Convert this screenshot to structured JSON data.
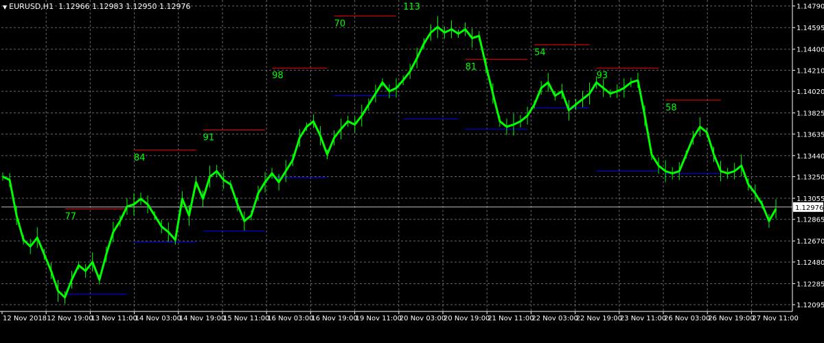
{
  "header": {
    "symbol": "EURUSD,H1",
    "ohlc": "1.12966 1.12983 1.12950 1.12976",
    "menu_icon": "triangle-down-icon"
  },
  "colors": {
    "background": "#000000",
    "grid": "#c0c0c0",
    "axis": "#ffffff",
    "candle": "#00ff00",
    "resistance": "#ff0000",
    "support": "#0000ff",
    "label": "#00ff00",
    "current_price_line": "#c0c0c0"
  },
  "chart_data": {
    "type": "line",
    "ylim": [
      1.12034,
      1.14844
    ],
    "y_ticks": [
      "1.14790",
      "1.14595",
      "1.14400",
      "1.14210",
      "1.14020",
      "1.13825",
      "1.13635",
      "1.13440",
      "1.13250",
      "1.13055",
      "1.12865",
      "1.12670",
      "1.12480",
      "1.12285",
      "1.12095"
    ],
    "x_ticks": [
      "12 Nov 2018",
      "12 Nov 19:00",
      "13 Nov 11:00",
      "14 Nov 03:00",
      "14 Nov 19:00",
      "15 Nov 11:00",
      "16 Nov 03:00",
      "16 Nov 19:00",
      "19 Nov 11:00",
      "20 Nov 03:00",
      "20 Nov 19:00",
      "21 Nov 11:00",
      "22 Nov 03:00",
      "22 Nov 19:00",
      "23 Nov 11:00",
      "26 Nov 03:00",
      "26 Nov 19:00",
      "27 Nov 11:00"
    ],
    "current_price": "1.12976",
    "price_series": [
      [
        0,
        1.1325
      ],
      [
        1,
        1.1322
      ],
      [
        2,
        1.129
      ],
      [
        3,
        1.1268
      ],
      [
        4,
        1.1262
      ],
      [
        5,
        1.127
      ],
      [
        6,
        1.1255
      ],
      [
        7,
        1.124
      ],
      [
        8,
        1.1222
      ],
      [
        9,
        1.1216
      ],
      [
        10,
        1.1232
      ],
      [
        11,
        1.1245
      ],
      [
        12,
        1.124
      ],
      [
        13,
        1.1248
      ],
      [
        14,
        1.1232
      ],
      [
        15,
        1.1255
      ],
      [
        16,
        1.1275
      ],
      [
        17,
        1.1285
      ],
      [
        18,
        1.1298
      ],
      [
        19,
        1.13
      ],
      [
        20,
        1.1305
      ],
      [
        21,
        1.13
      ],
      [
        22,
        1.129
      ],
      [
        23,
        1.128
      ],
      [
        24,
        1.1275
      ],
      [
        25,
        1.1268
      ],
      [
        26,
        1.1305
      ],
      [
        27,
        1.129
      ],
      [
        28,
        1.132
      ],
      [
        29,
        1.1305
      ],
      [
        30,
        1.1325
      ],
      [
        31,
        1.133
      ],
      [
        32,
        1.1322
      ],
      [
        33,
        1.1318
      ],
      [
        34,
        1.13
      ],
      [
        35,
        1.1285
      ],
      [
        36,
        1.129
      ],
      [
        37,
        1.131
      ],
      [
        38,
        1.132
      ],
      [
        39,
        1.1328
      ],
      [
        40,
        1.132
      ],
      [
        41,
        1.133
      ],
      [
        42,
        1.134
      ],
      [
        43,
        1.136
      ],
      [
        44,
        1.137
      ],
      [
        45,
        1.1375
      ],
      [
        46,
        1.1362
      ],
      [
        47,
        1.1345
      ],
      [
        48,
        1.136
      ],
      [
        49,
        1.1368
      ],
      [
        50,
        1.1375
      ],
      [
        51,
        1.1372
      ],
      [
        52,
        1.138
      ],
      [
        53,
        1.139
      ],
      [
        54,
        1.14
      ],
      [
        55,
        1.141
      ],
      [
        56,
        1.1402
      ],
      [
        57,
        1.1405
      ],
      [
        58,
        1.1412
      ],
      [
        59,
        1.142
      ],
      [
        60,
        1.1432
      ],
      [
        61,
        1.1445
      ],
      [
        62,
        1.1455
      ],
      [
        63,
        1.146
      ],
      [
        64,
        1.1455
      ],
      [
        65,
        1.1458
      ],
      [
        66,
        1.1454
      ],
      [
        67,
        1.1458
      ],
      [
        68,
        1.145
      ],
      [
        69,
        1.1452
      ],
      [
        70,
        1.1425
      ],
      [
        71,
        1.14
      ],
      [
        72,
        1.1375
      ],
      [
        73,
        1.137
      ],
      [
        74,
        1.1372
      ],
      [
        75,
        1.1375
      ],
      [
        76,
        1.138
      ],
      [
        77,
        1.139
      ],
      [
        78,
        1.1405
      ],
      [
        79,
        1.141
      ],
      [
        80,
        1.1398
      ],
      [
        81,
        1.1402
      ],
      [
        82,
        1.1385
      ],
      [
        83,
        1.139
      ],
      [
        84,
        1.1395
      ],
      [
        85,
        1.14
      ],
      [
        86,
        1.141
      ],
      [
        87,
        1.1405
      ],
      [
        88,
        1.14
      ],
      [
        89,
        1.1402
      ],
      [
        90,
        1.1405
      ],
      [
        91,
        1.141
      ],
      [
        92,
        1.1412
      ],
      [
        93,
        1.138
      ],
      [
        94,
        1.1345
      ],
      [
        95,
        1.1335
      ],
      [
        96,
        1.133
      ],
      [
        97,
        1.1328
      ],
      [
        98,
        1.133
      ],
      [
        99,
        1.1345
      ],
      [
        100,
        1.136
      ],
      [
        101,
        1.137
      ],
      [
        102,
        1.1365
      ],
      [
        103,
        1.1345
      ],
      [
        104,
        1.133
      ],
      [
        105,
        1.1328
      ],
      [
        106,
        1.133
      ],
      [
        107,
        1.1335
      ],
      [
        108,
        1.1318
      ],
      [
        109,
        1.131
      ],
      [
        110,
        1.13
      ],
      [
        111,
        1.1285
      ],
      [
        112,
        1.1296
      ]
    ],
    "levels": [
      {
        "label": "77",
        "high": 1.1296,
        "low": 1.1219,
        "from": 9,
        "to": 18
      },
      {
        "label": "84",
        "high": 1.1349,
        "low": 1.1266,
        "from": 19,
        "to": 28
      },
      {
        "label": "91",
        "high": 1.1367,
        "low": 1.1276,
        "from": 29,
        "to": 38
      },
      {
        "label": "98",
        "high": 1.1423,
        "low": 1.1324,
        "from": 39,
        "to": 47
      },
      {
        "label": "70",
        "high": 1.147,
        "low": 1.1398,
        "from": 48,
        "to": 57
      },
      {
        "label": "113",
        "high": 1.1485,
        "low": 1.1377,
        "from": 58,
        "to": 66
      },
      {
        "label": "81",
        "high": 1.1431,
        "low": 1.1368,
        "from": 67,
        "to": 76
      },
      {
        "label": "54",
        "high": 1.1444,
        "low": 1.1387,
        "from": 77,
        "to": 85
      },
      {
        "label": "93",
        "high": 1.1423,
        "low": 1.133,
        "from": 86,
        "to": 95
      },
      {
        "label": "58",
        "high": 1.1394,
        "low": 1.1328,
        "from": 96,
        "to": 104
      }
    ]
  }
}
